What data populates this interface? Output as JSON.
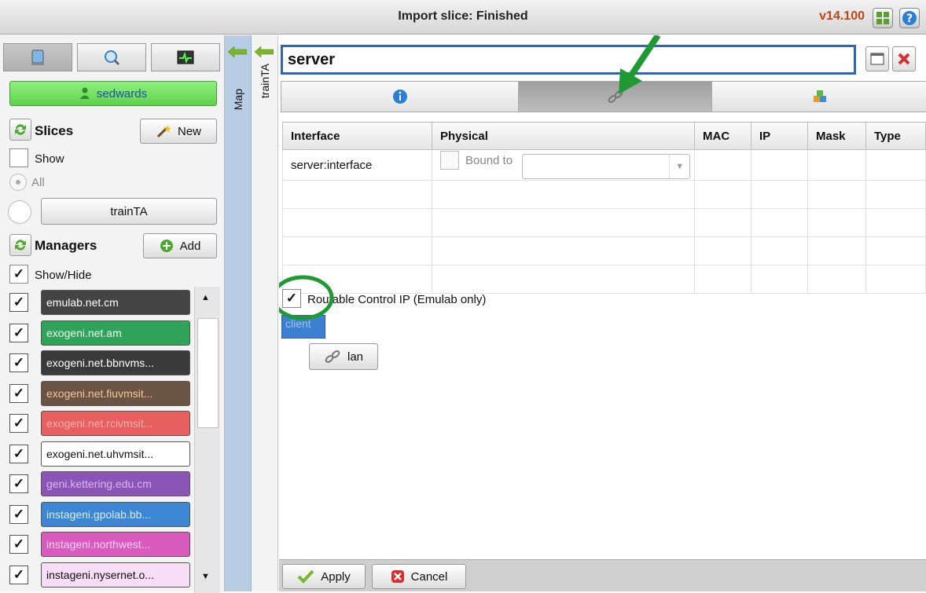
{
  "window": {
    "title": "Import slice: Finished",
    "version": "v14.100"
  },
  "left_tabs": [
    {
      "icon": "server-icon"
    },
    {
      "icon": "search-icon"
    },
    {
      "icon": "monitor-icon"
    }
  ],
  "user": {
    "name": "sedwards"
  },
  "slices": {
    "heading": "Slices",
    "new_label": "New",
    "show_label": "Show",
    "all_label": "All",
    "slice_button": "trainTA"
  },
  "managers": {
    "heading": "Managers",
    "add_label": "Add",
    "showhide_label": "Show/Hide",
    "items": [
      {
        "label": "emulab.net.cm",
        "bg": "#444444",
        "fg": "#ffffff"
      },
      {
        "label": "exogeni.net.am",
        "bg": "#2fa35a",
        "fg": "#e8fff0"
      },
      {
        "label": "exogeni.net.bbnvms...",
        "bg": "#3a3a3a",
        "fg": "#ffffff"
      },
      {
        "label": "exogeni.net.fiuvmsit...",
        "bg": "#6b5444",
        "fg": "#f3c79b"
      },
      {
        "label": "exogeni.net.rcivmsit...",
        "bg": "#e85f5f",
        "fg": "#ffb1b1"
      },
      {
        "label": "exogeni.net.uhvmsit...",
        "bg": "#ffffff",
        "fg": "#111111"
      },
      {
        "label": "geni.kettering.edu.cm",
        "bg": "#8b55b8",
        "fg": "#d9b8f2"
      },
      {
        "label": "instageni.gpolab.bb...",
        "bg": "#3d86d3",
        "fg": "#d9ecff"
      },
      {
        "label": "instageni.northwest...",
        "bg": "#d95bbd",
        "fg": "#ffd1f3"
      },
      {
        "label": "instageni.nysernet.o...",
        "bg": "#f7ddf5",
        "fg": "#111111"
      }
    ]
  },
  "side_tabs": {
    "map": "Map",
    "slice": "trainTA"
  },
  "node": {
    "name": "server",
    "columns": [
      "Interface",
      "Physical",
      "MAC",
      "IP",
      "Mask",
      "Type"
    ],
    "rows": [
      {
        "interface": "server:interface",
        "bound_label": "Bound to"
      }
    ],
    "routable_label": "Routable Control IP (Emulab only)",
    "client_label": "client",
    "lan_label": "lan"
  },
  "buttons": {
    "apply": "Apply",
    "cancel": "Cancel"
  }
}
